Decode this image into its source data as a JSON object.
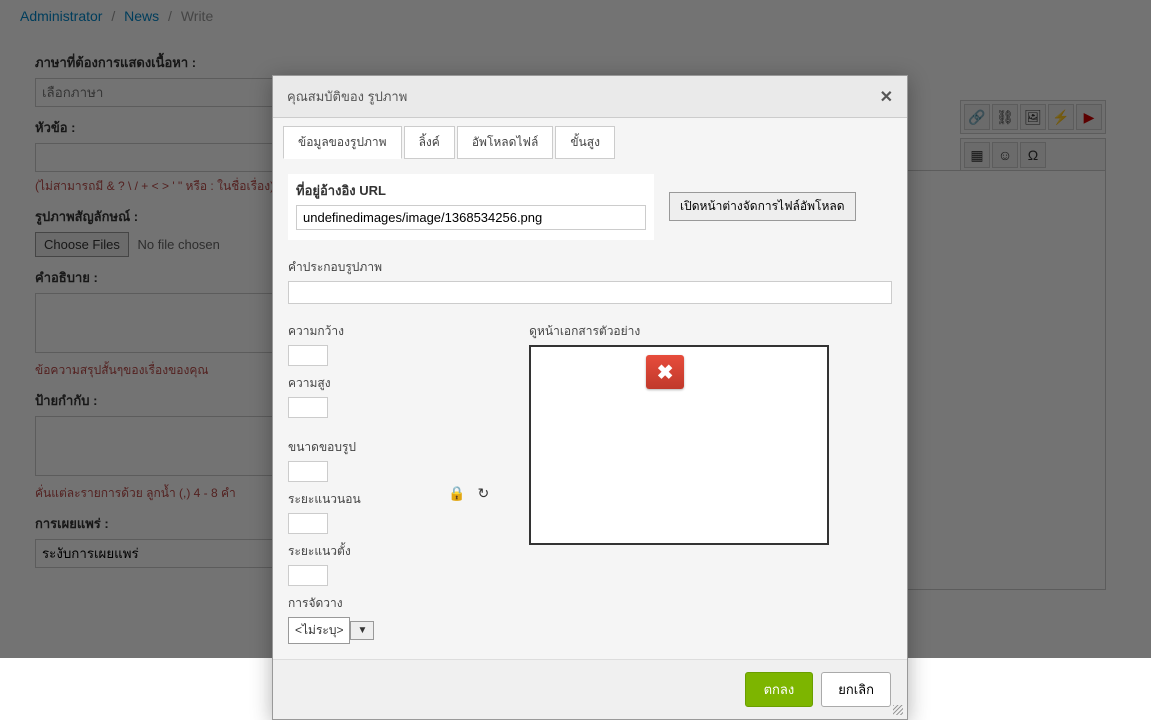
{
  "breadcrumb": {
    "item1": "Administrator",
    "item2": "News",
    "item3": "Write"
  },
  "form": {
    "lang_label": "ภาษาที่ต้องการแสดงเนื้อหา :",
    "lang_placeholder": "เลือกภาษา",
    "title_label": "หัวข้อ :",
    "title_hint": "(ไม่สามารถมี & ? \\ / + < > ' \" หรือ : ในชื่อเรื่อง)",
    "symbol_label": "รูปภาพสัญลักษณ์ :",
    "choose_files": "Choose Files",
    "no_file": "No file chosen",
    "desc_label": "คำอธิบาย :",
    "summary_hint": "ข้อความสรุปสั้นๆของเรื่องของคุณ",
    "tags_label": "ป้ายกำกับ :",
    "tags_hint": "คั่นแต่ละรายการด้วย ลูกน้ำ (,) 4 - 8 คำ",
    "publish_label": "การเผยแพร่ :",
    "publish_value": "ระงับการเผยแพร่"
  },
  "dialog": {
    "title": "คุณสมบัติของ รูปภาพ",
    "tabs": {
      "info": "ข้อมูลของรูปภาพ",
      "link": "ลิ้งค์",
      "upload": "อัพโหลดไฟล์",
      "advanced": "ขั้นสูง"
    },
    "url_label": "ที่อยู่อ้างอิง URL",
    "url_value": "undefinedimages/image/1368534256.png",
    "browse_btn": "เปิดหน้าต่างจัดการไฟล์อัพโหลด",
    "alt_label": "คำประกอบรูปภาพ",
    "width_label": "ความกว้าง",
    "height_label": "ความสูง",
    "border_label": "ขนาดขอบรูป",
    "hspace_label": "ระยะแนวนอน",
    "vspace_label": "ระยะแนวตั้ง",
    "align_label": "การจัดวาง",
    "align_value": "<ไม่ระบุ>",
    "preview_label": "ดูหน้าเอกสารตัวอย่าง",
    "ok": "ตกลง",
    "cancel": "ยกเลิก"
  }
}
